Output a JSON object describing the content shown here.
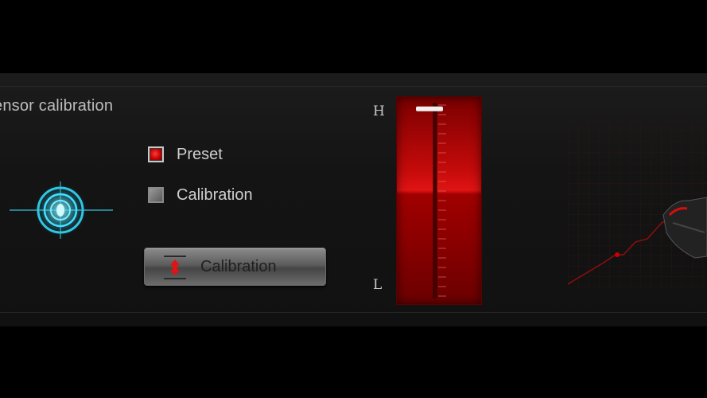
{
  "panel": {
    "title": "ensor calibration"
  },
  "options": [
    {
      "label": "Preset",
      "checked": true
    },
    {
      "label": "Calibration",
      "checked": false
    }
  ],
  "calibration_button": {
    "label": "Calibration"
  },
  "gauge": {
    "high_label": "H",
    "low_label": "L",
    "level_fraction": 0.98
  },
  "colors": {
    "accent_red": "#d10f0f",
    "glow_cyan": "#3fe3ff",
    "panel_bg": "#161616"
  },
  "icons": {
    "target": "crosshair-target-icon",
    "calibrate": "up-down-arrows-icon"
  }
}
